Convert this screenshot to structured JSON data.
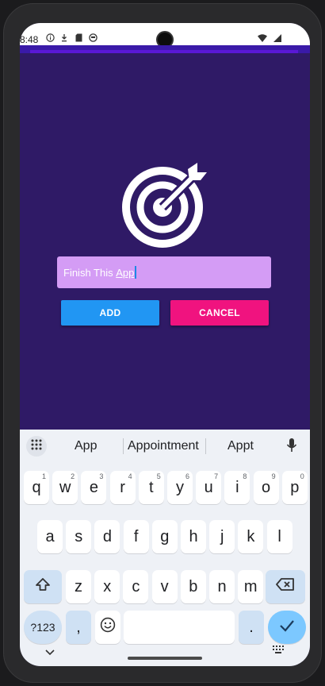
{
  "status": {
    "time": "8:48",
    "left_icons": [
      "info-icon",
      "download-icon",
      "sd-card-icon",
      "circle-icon"
    ],
    "right_icons": [
      "wifi-icon",
      "battery-icon"
    ]
  },
  "app": {
    "input_value_typed": "Finish This ",
    "input_value_composing": "App",
    "add_label": "ADD",
    "cancel_label": "CANCEL",
    "icon": "target-arrow-icon"
  },
  "keyboard": {
    "suggestions": [
      "App",
      "Appointment",
      "Appt"
    ],
    "row1": [
      "q",
      "w",
      "e",
      "r",
      "t",
      "y",
      "u",
      "i",
      "o",
      "p"
    ],
    "row1_hints": [
      "1",
      "2",
      "3",
      "4",
      "5",
      "6",
      "7",
      "8",
      "9",
      "0"
    ],
    "row2": [
      "a",
      "s",
      "d",
      "f",
      "g",
      "h",
      "j",
      "k",
      "l"
    ],
    "row3": [
      "z",
      "x",
      "c",
      "v",
      "b",
      "n",
      "m"
    ],
    "symbols_label": "?123",
    "comma_label": ",",
    "period_label": "."
  },
  "colors": {
    "app_bg": "#2f1a66",
    "input_bg": "#d49cf5",
    "add": "#2196f3",
    "cancel": "#f0137f"
  }
}
